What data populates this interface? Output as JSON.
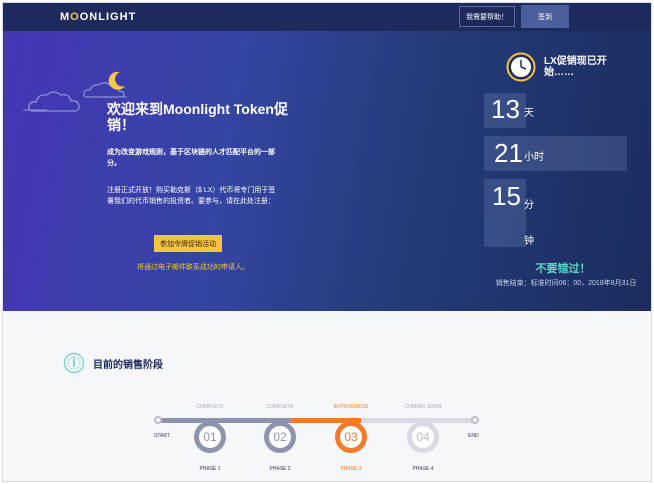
{
  "nav": {
    "logo_prefix": "M",
    "logo_moon": "O",
    "logo_rest": "ONLIGHT",
    "help_label": "我需要帮助！",
    "login_label": "签到"
  },
  "hero": {
    "title": "欢迎来到Moonlight Token促销！",
    "subtitle": "成为改变游戏规则，基于区块链的人才匹配平台的一部分。",
    "description": "注册正式开放！购买勒克斯（$ LX）代币将专门用于签署我们的代币销售的投资者。要参与，请在此处注册：",
    "cta_label": "参加令牌促销活动",
    "note": "将通过电子邮件联系成功的申请人。"
  },
  "countdown": {
    "title": "LX促销现已开始……",
    "days": "13",
    "days_unit": "天",
    "hours": "21",
    "hours_unit": "小时",
    "minutes": "15",
    "minutes_unit": "分钟",
    "dont_miss": "不要错过！",
    "sale_end": "销售结束：标准时间06：00，2018年8月31日"
  },
  "stages": {
    "title": "目前的销售阶段",
    "start_label": "START",
    "end_label": "END",
    "phases": [
      {
        "state": "COMPLETE",
        "num": "01",
        "label": "PHASE 1"
      },
      {
        "state": "COMPLETE",
        "num": "02",
        "label": "PHASE 2"
      },
      {
        "state": "IN PROGRESS",
        "num": "03",
        "label": "PHASE 3"
      },
      {
        "state": "COMING SOON",
        "num": "04",
        "label": "PHASE 4"
      }
    ]
  },
  "colors": {
    "nav_bg": "#1e2a5c",
    "accent_yellow": "#f5c242",
    "progress_orange": "#f37a2a",
    "complete_gray": "#8e94ad",
    "upcoming_gray": "#d7dae4",
    "teal": "#5dd6c8"
  }
}
